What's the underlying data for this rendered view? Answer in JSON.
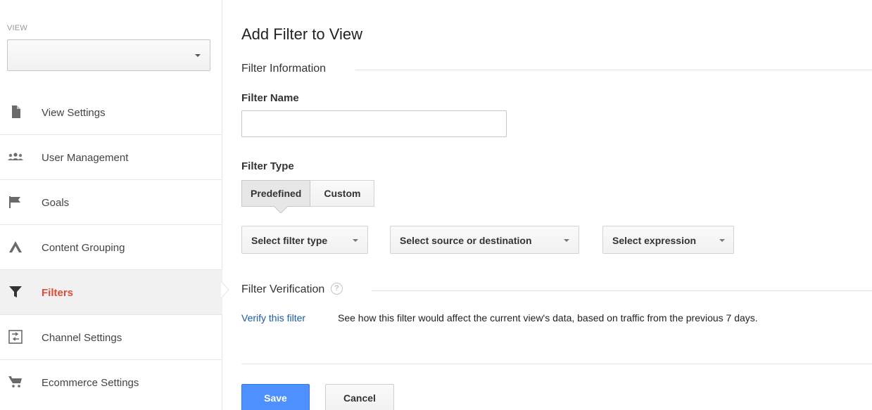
{
  "sidebar": {
    "view_label": "VIEW",
    "view_select_value": "",
    "items": [
      {
        "label": "View Settings",
        "icon": "document-icon"
      },
      {
        "label": "User Management",
        "icon": "users-icon"
      },
      {
        "label": "Goals",
        "icon": "flag-icon"
      },
      {
        "label": "Content Grouping",
        "icon": "content-grouping-icon"
      },
      {
        "label": "Filters",
        "icon": "filter-icon",
        "active": true
      },
      {
        "label": "Channel Settings",
        "icon": "channel-settings-icon"
      },
      {
        "label": "Ecommerce Settings",
        "icon": "cart-icon"
      }
    ]
  },
  "main": {
    "title": "Add Filter to View",
    "filter_information": "Filter Information",
    "filter_name_label": "Filter Name",
    "filter_name_value": "",
    "filter_type_label": "Filter Type",
    "toggle": {
      "predefined": "Predefined",
      "custom": "Custom",
      "selected": "Predefined"
    },
    "dropdowns": {
      "filter_type": "Select filter type",
      "source_destination": "Select source or destination",
      "expression": "Select expression"
    },
    "filter_verification": "Filter Verification",
    "help_glyph": "?",
    "verify_link": "Verify this filter",
    "verify_description": "See how this filter would affect the current view's data, based on traffic from the previous 7 days.",
    "save_label": "Save",
    "cancel_label": "Cancel"
  },
  "colors": {
    "accent_red": "#dd4b39",
    "primary_blue": "#4d90fe",
    "link_blue": "#1a5ba6"
  }
}
